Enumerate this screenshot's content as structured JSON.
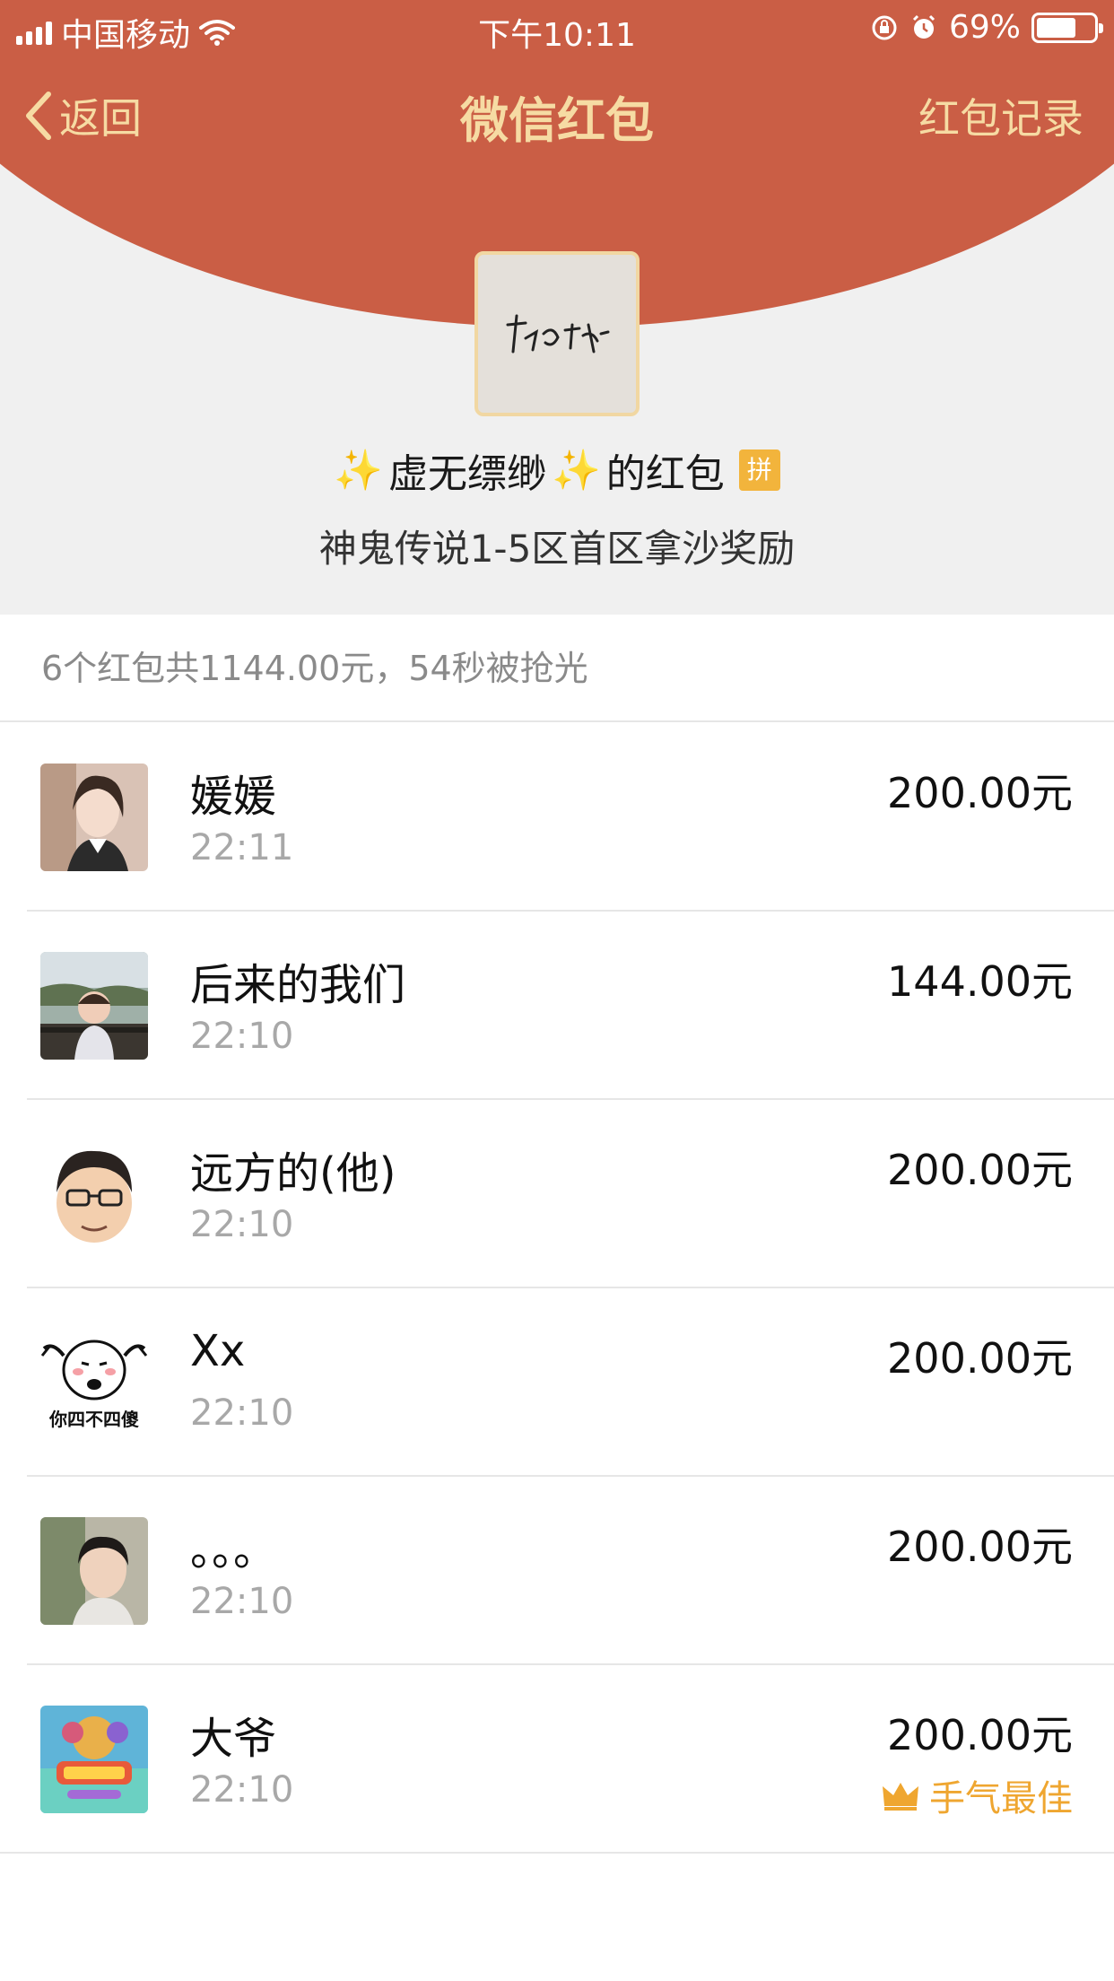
{
  "status_bar": {
    "carrier": "中国移动",
    "time": "下午10:11",
    "battery_percent": "69%",
    "battery_level": 0.69
  },
  "nav": {
    "back_label": "返回",
    "title": "微信红包",
    "record_label": "红包记录"
  },
  "sender": {
    "name_prefix": "✨",
    "name": " 虚无缥缈",
    "name_suffix": "✨",
    "name_tail": "的红包",
    "badge": "拼",
    "greeting": "神鬼传说1-5区首区拿沙奖励"
  },
  "summary": "6个红包共1144.00元，54秒被抢光",
  "recipients": [
    {
      "name": "媛媛",
      "time": "22:11",
      "amount": "200.00元",
      "best": "",
      "avatar_color": "#c9a89a"
    },
    {
      "name": "后来的我们",
      "time": "22:10",
      "amount": "144.00元",
      "best": "",
      "avatar_color": "#7e8f6a"
    },
    {
      "name": "远方的(他)",
      "time": "22:10",
      "amount": "200.00元",
      "best": "",
      "avatar_color": "#e9d2b8"
    },
    {
      "name": "Xx",
      "time": "22:10",
      "amount": "200.00元",
      "best": "",
      "avatar_color": "#ffffff",
      "avatar_caption": "你四不四傻"
    },
    {
      "name": "。。。",
      "time": "22:10",
      "amount": "200.00元",
      "best": "",
      "avatar_color": "#8c8a7c"
    },
    {
      "name": "大爷",
      "time": "22:10",
      "amount": "200.00元",
      "best": "手气最佳",
      "avatar_color": "#6d7fd6"
    }
  ],
  "colors": {
    "header_red": "#ca5e45",
    "nav_gold": "#f6dba3",
    "best_luck": "#efa630"
  }
}
